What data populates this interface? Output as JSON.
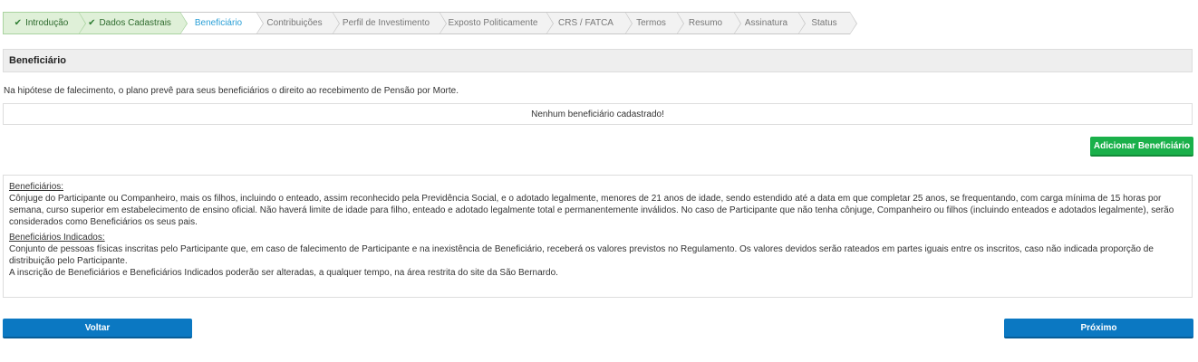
{
  "steps": [
    {
      "label": "Introdução",
      "state": "done"
    },
    {
      "label": "Dados Cadastrais",
      "state": "done"
    },
    {
      "label": "Beneficiário",
      "state": "active"
    },
    {
      "label": "Contribuições",
      "state": "pending"
    },
    {
      "label": "Perfil de Investimento",
      "state": "pending"
    },
    {
      "label": "Exposto Politicamente",
      "state": "pending"
    },
    {
      "label": "CRS / FATCA",
      "state": "pending"
    },
    {
      "label": "Termos",
      "state": "pending"
    },
    {
      "label": "Resumo",
      "state": "pending"
    },
    {
      "label": "Assinatura",
      "state": "pending"
    },
    {
      "label": "Status",
      "state": "pending"
    }
  ],
  "section": {
    "title": "Beneficiário",
    "intro": "Na hipótese de falecimento, o plano prevê para seus beneficiários o direito ao recebimento de Pensão por Morte.",
    "empty_message": "Nenhum beneficiário cadastrado!",
    "add_button": "Adicionar Beneficiário"
  },
  "info": {
    "heading1": "Beneficiários:",
    "text1": "Cônjuge do Participante ou Companheiro, mais os filhos, incluindo o enteado, assim reconhecido pela Previdência Social, e o adotado legalmente, menores de 21 anos de idade, sendo estendido até a data em que completar 25 anos, se frequentando, com carga mínima de 15 horas por semana, curso superior em estabelecimento de ensino oficial. Não haverá limite de idade para filho, enteado e adotado legalmente total e permanentemente inválidos. No caso de Participante que não tenha cônjuge, Companheiro ou filhos (incluindo enteados e adotados legalmente), serão considerados como Beneficiários os seus pais.",
    "heading2": "Beneficiários Indicados:",
    "text2": "Conjunto de pessoas físicas inscritas pelo Participante que, em caso de falecimento de Participante e na inexistência de Beneficiário, receberá os valores previstos no Regulamento. Os valores devidos serão rateados em partes iguais entre os inscritos, caso não indicada proporção de distribuição pelo Participante.",
    "text3": "A inscrição de Beneficiários e Beneficiários Indicados poderão ser alteradas, a qualquer tempo, na área restrita do site da São Bernardo."
  },
  "nav": {
    "back": "Voltar",
    "next": "Próximo"
  },
  "colors": {
    "done_bg": "#dff0d8",
    "active_text": "#2a9fd6",
    "green_button": "#1ab04a",
    "blue_button": "#0b78c2"
  }
}
